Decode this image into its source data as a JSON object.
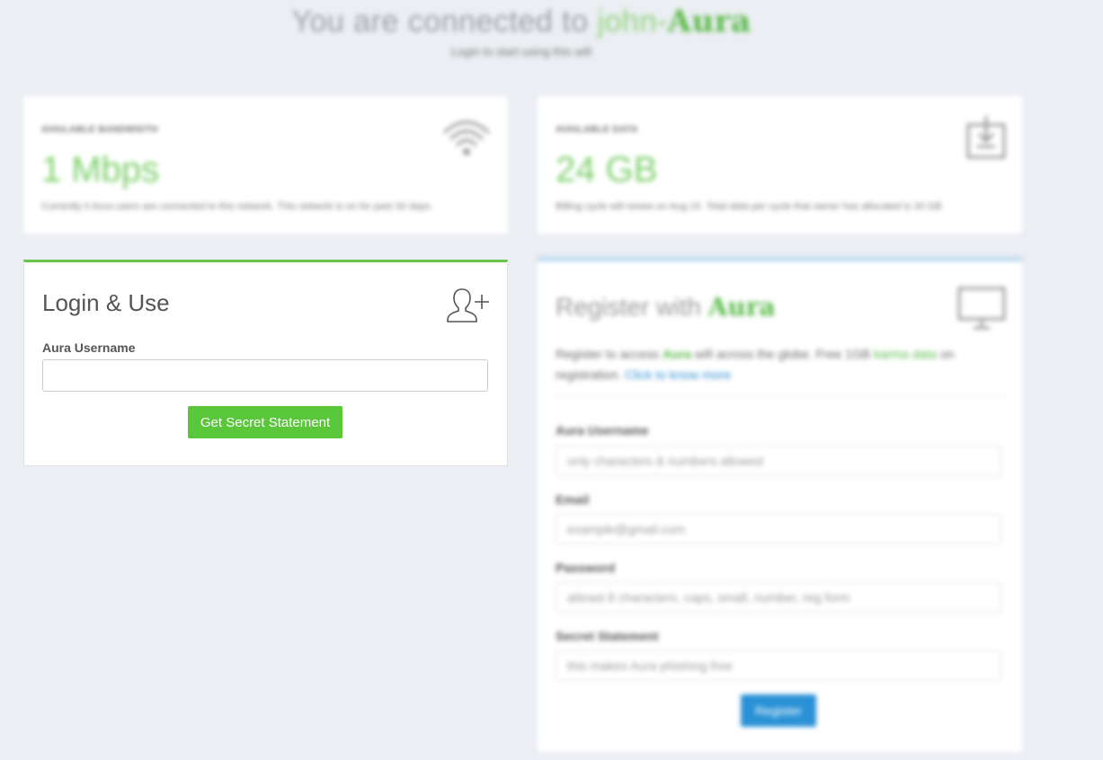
{
  "header": {
    "title_prefix": "You are connected to ",
    "title_network_a": "john-",
    "title_network_b": "Aura",
    "subtitle": "Login to start using this wifi"
  },
  "bandwidth": {
    "label": "AVAILABLE BANDWIDTH",
    "value": "1 Mbps",
    "description": "Currently 0 Aura users are connected to this network. This network is on for past 30 days.",
    "icon": "wifi-icon"
  },
  "data_stat": {
    "label": "AVAILABLE DATA",
    "value": "24 GB",
    "description": "Billing cycle will renew on Aug 15. Total data per cycle that owner has allocated is 30 GB",
    "icon": "download-box-icon"
  },
  "login": {
    "title": "Login & Use",
    "icon": "add-user-icon",
    "username_label": "Aura Username",
    "username_value": "",
    "button_label": "Get Secret Statement"
  },
  "register": {
    "title_prefix": "Register with ",
    "title_brand": "Aura",
    "icon": "monitor-icon",
    "intro_1": "Register to access ",
    "intro_brand": "Aura",
    "intro_2": " wifi across the globe. Free 1GB ",
    "intro_karma": "karma data",
    "intro_3": " on registration. ",
    "intro_link": "Click to know more",
    "fields": [
      {
        "label": "Aura Username",
        "placeholder": "only characters & numbers allowed"
      },
      {
        "label": "Email",
        "placeholder": "example@gmail.com"
      },
      {
        "label": "Password",
        "placeholder": "atleast 8 characters, caps, small, number, reg form"
      },
      {
        "label": "Secret Statement",
        "placeholder": "this makes Aura phishing free"
      }
    ],
    "button_label": "Register"
  },
  "colors": {
    "accent_green": "#5ac73a",
    "stat_green": "#7ccf6a",
    "accent_blue": "#2a91d6",
    "background": "#ebeef2"
  }
}
